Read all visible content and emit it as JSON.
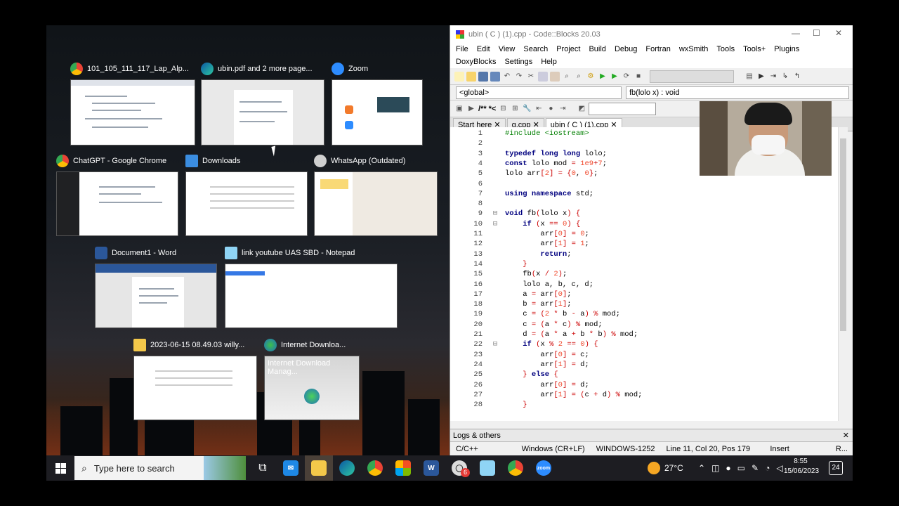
{
  "switcher": {
    "windows": [
      {
        "title": "101_105_111_117_Lap_Alp...",
        "icon": "chrome-icon"
      },
      {
        "title": "ubin.pdf and 2 more page...",
        "icon": "edge-icon"
      },
      {
        "title": "Zoom",
        "icon": "zoom-icon"
      },
      {
        "title": "ChatGPT - Google Chrome",
        "icon": "chrome-icon"
      },
      {
        "title": "Downloads",
        "icon": "download-arrow-icon"
      },
      {
        "title": "WhatsApp (Outdated)",
        "icon": "whatsapp-icon"
      },
      {
        "title": "Document1 - Word",
        "icon": "word-icon"
      },
      {
        "title": "link youtube UAS SBD - Notepad",
        "icon": "notepad-icon"
      },
      {
        "title": "2023-06-15 08.49.03 willy...",
        "icon": "folder-icon"
      },
      {
        "title": "Internet Downloa...",
        "icon": "idm-icon"
      }
    ],
    "idm_thumb_text": "Internet Download Manag..."
  },
  "codeblocks": {
    "title": "ubin ( C ) (1).cpp - Code::Blocks 20.03",
    "menu": [
      "File",
      "Edit",
      "View",
      "Search",
      "Project",
      "Build",
      "Debug",
      "Fortran",
      "wxSmith",
      "Tools",
      "Tools+",
      "Plugins",
      "DoxyBlocks",
      "Settings",
      "Help"
    ],
    "scope": "<global>",
    "function": "fb(lolo x) : void",
    "doxy_labels": [
      "/**",
      "*<"
    ],
    "tabs": [
      "Start here",
      "g.cpp",
      "ubin ( C ) (1).cpp"
    ],
    "code_lines": [
      {
        "n": "1",
        "text": "#include <iostream>"
      },
      {
        "n": "2",
        "text": ""
      },
      {
        "n": "3",
        "text": "typedef long long lolo;"
      },
      {
        "n": "4",
        "text": "const lolo mod = 1e9+7;"
      },
      {
        "n": "5",
        "text": "lolo arr[2] = {0, 0};"
      },
      {
        "n": "6",
        "text": ""
      },
      {
        "n": "7",
        "text": "using namespace std;"
      },
      {
        "n": "8",
        "text": ""
      },
      {
        "n": "9",
        "text": "void fb(lolo x) {"
      },
      {
        "n": "10",
        "text": "    if (x == 0) {"
      },
      {
        "n": "11",
        "text": "        arr[0] = 0;"
      },
      {
        "n": "12",
        "text": "        arr[1] = 1;"
      },
      {
        "n": "13",
        "text": "        return;"
      },
      {
        "n": "14",
        "text": "    }"
      },
      {
        "n": "15",
        "text": "    fb(x / 2);"
      },
      {
        "n": "16",
        "text": "    lolo a, b, c, d;"
      },
      {
        "n": "17",
        "text": "    a = arr[0];"
      },
      {
        "n": "18",
        "text": "    b = arr[1];"
      },
      {
        "n": "19",
        "text": "    c = (2 * b - a) % mod;"
      },
      {
        "n": "20",
        "text": "    c = (a * c) % mod;"
      },
      {
        "n": "21",
        "text": "    d = (a * a + b * b) % mod;"
      },
      {
        "n": "22",
        "text": "    if (x % 2 == 0) {"
      },
      {
        "n": "23",
        "text": "        arr[0] = c;"
      },
      {
        "n": "24",
        "text": "        arr[1] = d;"
      },
      {
        "n": "25",
        "text": "    } else {"
      },
      {
        "n": "26",
        "text": "        arr[0] = d;"
      },
      {
        "n": "27",
        "text": "        arr[1] = (c + d) % mod;"
      },
      {
        "n": "28",
        "text": "    }"
      }
    ],
    "logs_label": "Logs & others",
    "status": {
      "lang": "C/C++",
      "eol": "Windows (CR+LF)",
      "encoding": "WINDOWS-1252",
      "position": "Line 11, Col 20, Pos 179",
      "mode": "Insert",
      "rw": "R..."
    }
  },
  "taskbar": {
    "search_placeholder": "Type here to search",
    "weather": "27°C",
    "time": "8:55",
    "date": "15/06/2023",
    "notifications": "24",
    "badge_count": "6"
  }
}
